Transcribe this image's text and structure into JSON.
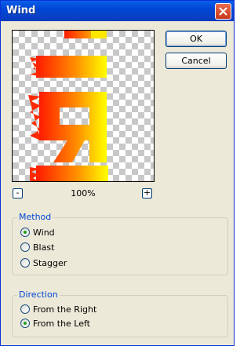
{
  "window": {
    "title": "Wind"
  },
  "buttons": {
    "ok": "OK",
    "cancel": "Cancel"
  },
  "zoom": {
    "minus": "-",
    "plus": "+",
    "level": "100%"
  },
  "method": {
    "label": "Method",
    "options": [
      "Wind",
      "Blast",
      "Stagger"
    ],
    "selected": "Wind"
  },
  "direction": {
    "label": "Direction",
    "options": [
      "From the Right",
      "From the Left"
    ],
    "selected": "From the Left"
  },
  "colors": {
    "accent": "#0046d5",
    "radio_dot": "#21a121",
    "gradient_start": "#ff1a00",
    "gradient_end": "#ffff00"
  },
  "icons": {
    "close": "close-icon"
  }
}
